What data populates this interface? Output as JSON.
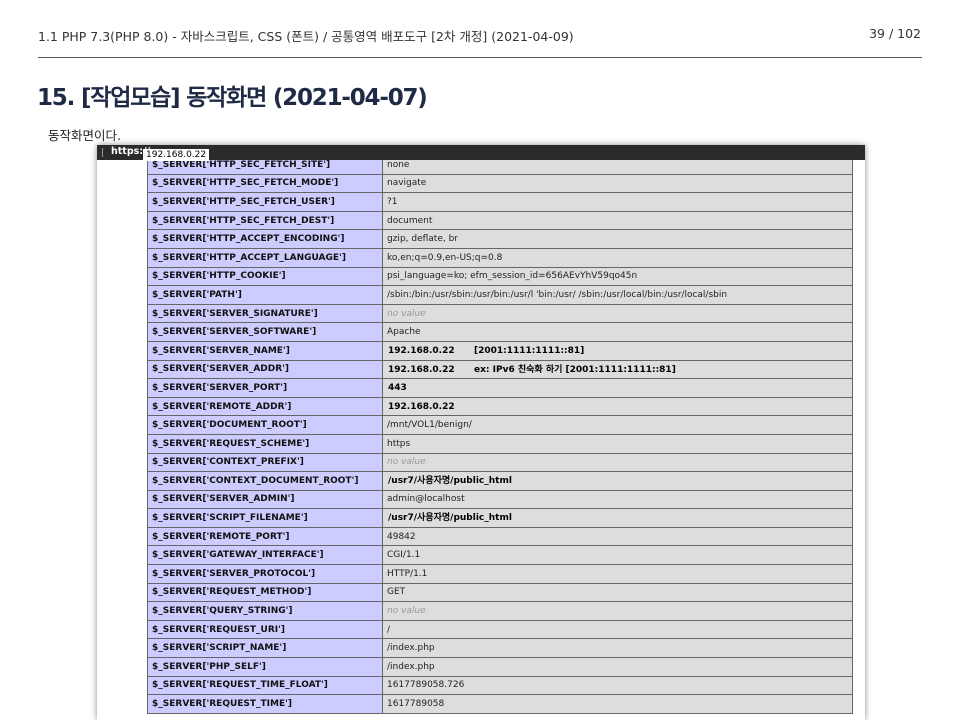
{
  "header": {
    "title": "1.1 PHP 7.3(PHP 8.0) - 자바스크립트, CSS (폰트) / 공통영역 배포도구 [2차 개정] (2021-04-09)",
    "page": "39 / 102"
  },
  "section": {
    "heading": "15. [작업모습] 동작화면 (2021-04-07)",
    "intro": "동작화면이다."
  },
  "browser": {
    "protocol": "https://",
    "host": "192.168.0.22"
  },
  "server_rows": [
    {
      "key": "$_SERVER['HTTP_SEC_FETCH_SITE']",
      "value": "none"
    },
    {
      "key": "$_SERVER['HTTP_SEC_FETCH_MODE']",
      "value": "navigate"
    },
    {
      "key": "$_SERVER['HTTP_SEC_FETCH_USER']",
      "value": "?1"
    },
    {
      "key": "$_SERVER['HTTP_SEC_FETCH_DEST']",
      "value": "document"
    },
    {
      "key": "$_SERVER['HTTP_ACCEPT_ENCODING']",
      "value": "gzip, deflate, br"
    },
    {
      "key": "$_SERVER['HTTP_ACCEPT_LANGUAGE']",
      "value": "ko,en;q=0.9,en-US;q=0.8"
    },
    {
      "key": "$_SERVER['HTTP_COOKIE']",
      "value": "psi_language=ko; efm_session_id=656AEvYhV59qo45n"
    },
    {
      "key": "$_SERVER['PATH']",
      "value": "/sbin:/bin:/usr/sbin:/usr/bin:/usr/l            'bin:/usr/            /sbin:/usr/local/bin:/usr/local/sbin"
    },
    {
      "key": "$_SERVER['SERVER_SIGNATURE']",
      "value": "no value",
      "novalue": true
    },
    {
      "key": "$_SERVER['SERVER_SOFTWARE']",
      "value": "Apache"
    },
    {
      "key": "$_SERVER['SERVER_NAME']",
      "value": "",
      "overlays": [
        "192.168.0.22",
        "[2001:1111:1111::81]"
      ]
    },
    {
      "key": "$_SERVER['SERVER_ADDR']",
      "value": "",
      "overlays": [
        "192.168.0.22",
        "ex: IPv6 친숙화 하기 [2001:1111:1111::81]"
      ]
    },
    {
      "key": "$_SERVER['SERVER_PORT']",
      "value": "",
      "overlays": [
        "443"
      ]
    },
    {
      "key": "$_SERVER['REMOTE_ADDR']",
      "value": "",
      "overlays": [
        "192.168.0.22"
      ]
    },
    {
      "key": "$_SERVER['DOCUMENT_ROOT']",
      "value": "/mnt/VOL1/benign/"
    },
    {
      "key": "$_SERVER['REQUEST_SCHEME']",
      "value": "https"
    },
    {
      "key": "$_SERVER['CONTEXT_PREFIX']",
      "value": "no value",
      "novalue": true
    },
    {
      "key": "$_SERVER['CONTEXT_DOCUMENT_ROOT']",
      "value": "",
      "overlays": [
        "/usr7/사용자명/public_html"
      ]
    },
    {
      "key": "$_SERVER['SERVER_ADMIN']",
      "value": "admin@localhost"
    },
    {
      "key": "$_SERVER['SCRIPT_FILENAME']",
      "value": "",
      "overlays": [
        "/usr7/사용자명/public_html"
      ]
    },
    {
      "key": "$_SERVER['REMOTE_PORT']",
      "value": "49842"
    },
    {
      "key": "$_SERVER['GATEWAY_INTERFACE']",
      "value": "CGI/1.1"
    },
    {
      "key": "$_SERVER['SERVER_PROTOCOL']",
      "value": "HTTP/1.1"
    },
    {
      "key": "$_SERVER['REQUEST_METHOD']",
      "value": "GET"
    },
    {
      "key": "$_SERVER['QUERY_STRING']",
      "value": "no value",
      "novalue": true
    },
    {
      "key": "$_SERVER['REQUEST_URI']",
      "value": "/"
    },
    {
      "key": "$_SERVER['SCRIPT_NAME']",
      "value": "/index.php"
    },
    {
      "key": "$_SERVER['PHP_SELF']",
      "value": "/index.php"
    },
    {
      "key": "$_SERVER['REQUEST_TIME_FLOAT']",
      "value": "1617789058.726"
    },
    {
      "key": "$_SERVER['REQUEST_TIME']",
      "value": "1617789058"
    }
  ],
  "colors": {
    "key_cell": "#ccccff",
    "value_cell": "#dddddd",
    "heading": "#1f2a44"
  }
}
